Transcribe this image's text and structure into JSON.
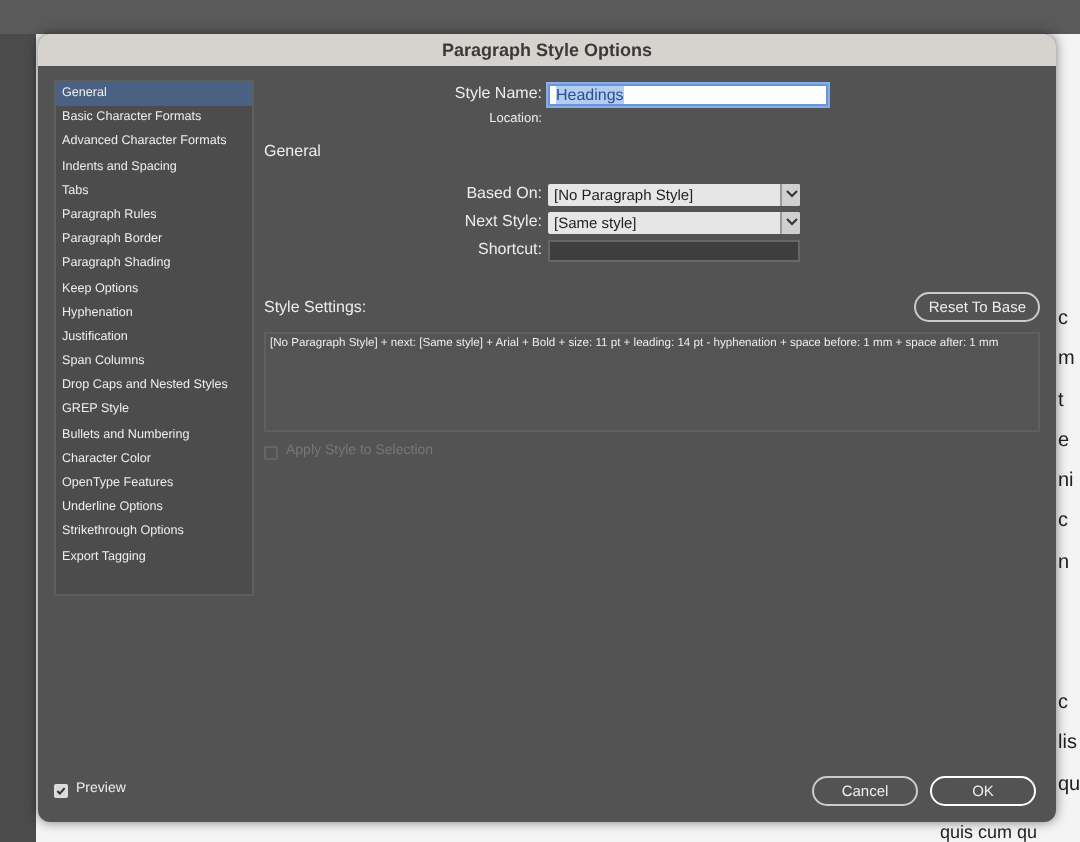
{
  "window": {
    "title": "Paragraph Style Options"
  },
  "sidebar": {
    "items": [
      {
        "label": "General",
        "selected": true
      },
      {
        "label": "Basic Character Formats",
        "selected": false
      },
      {
        "label": "Advanced Character Formats",
        "selected": false
      },
      {
        "label": "Indents and Spacing",
        "selected": false
      },
      {
        "label": "Tabs",
        "selected": false
      },
      {
        "label": "Paragraph Rules",
        "selected": false
      },
      {
        "label": "Paragraph Border",
        "selected": false
      },
      {
        "label": "Paragraph Shading",
        "selected": false
      },
      {
        "label": "Keep Options",
        "selected": false
      },
      {
        "label": "Hyphenation",
        "selected": false
      },
      {
        "label": "Justification",
        "selected": false
      },
      {
        "label": "Span Columns",
        "selected": false
      },
      {
        "label": "Drop Caps and Nested Styles",
        "selected": false
      },
      {
        "label": "GREP Style",
        "selected": false
      },
      {
        "label": "Bullets and Numbering",
        "selected": false
      },
      {
        "label": "Character Color",
        "selected": false
      },
      {
        "label": "OpenType Features",
        "selected": false
      },
      {
        "label": "Underline Options",
        "selected": false
      },
      {
        "label": "Strikethrough Options",
        "selected": false
      },
      {
        "label": "Export Tagging",
        "selected": false
      }
    ]
  },
  "style_name": {
    "label": "Style Name:",
    "value": "Headings"
  },
  "location": {
    "label": "Location:"
  },
  "section_title": "General",
  "fields": [
    {
      "kind": "select",
      "label": "Based On:",
      "value": "[No Paragraph Style]"
    },
    {
      "kind": "select",
      "label": "Next Style:",
      "value": "[Same style]"
    },
    {
      "kind": "text",
      "label": "Shortcut:"
    }
  ],
  "style_settings": {
    "label": "Style Settings:",
    "reset_button": "Reset To Base",
    "text": "[No Paragraph Style] + next: [Same style] + Arial + Bold + size: 11 pt + leading: 14 pt - hyphenation + space before: 1 mm + space after: 1 mm"
  },
  "apply_to_selection": {
    "label": "Apply Style to Selection",
    "checked": false,
    "disabled": true
  },
  "preview": {
    "label": "Preview",
    "checked": true
  },
  "buttons": [
    "Cancel",
    "OK"
  ],
  "document_fragments": [
    "c",
    "m",
    "t",
    "e",
    "ni",
    "c",
    "n",
    "c",
    "lis",
    "qu",
    "quis cum qu"
  ]
}
